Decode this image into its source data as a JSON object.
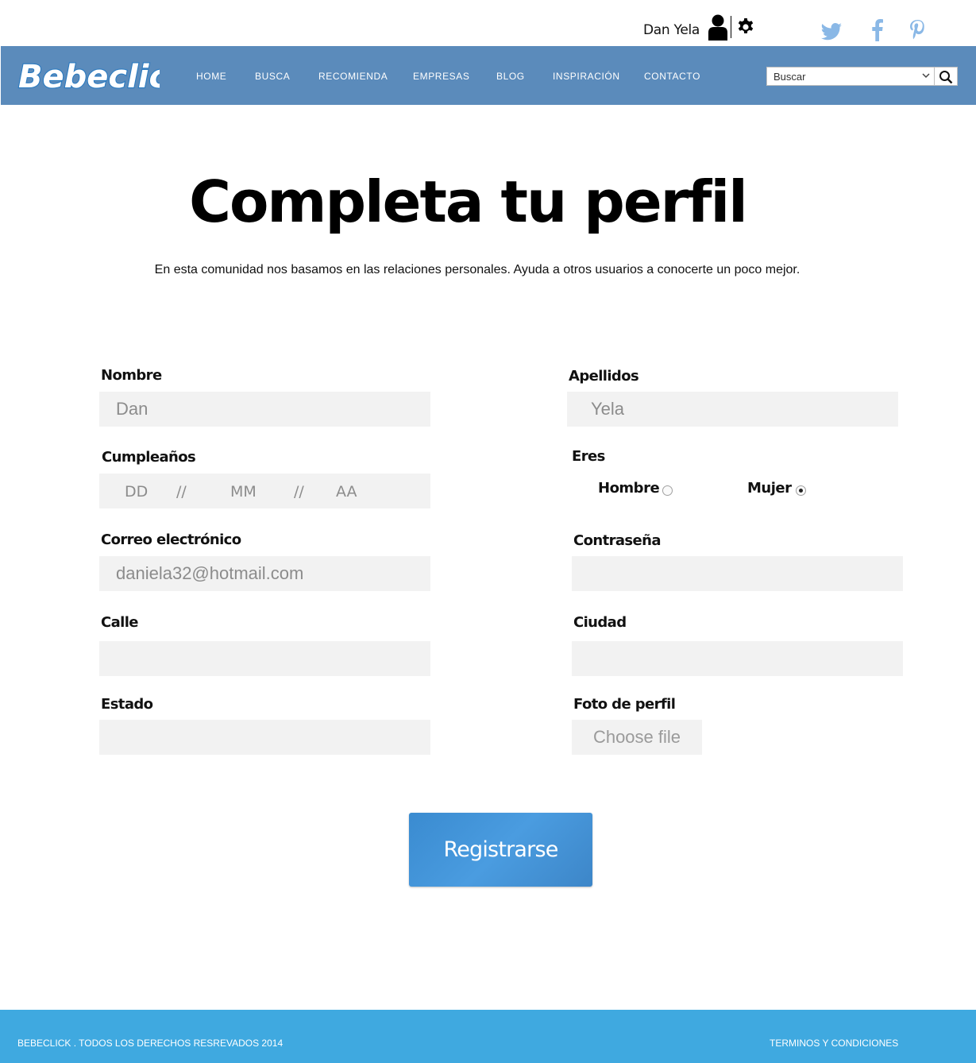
{
  "user": {
    "name": "Dan Yela"
  },
  "icons": {
    "user": "user-icon",
    "settings": "gear-icon",
    "social": [
      "twitter-icon",
      "facebook-icon",
      "pinterest-icon"
    ]
  },
  "brand": {
    "logo_text": "Bebeclick",
    "nav_color": "#5b8bbb",
    "footer_color": "#3fa9e0",
    "button_color": "#4a9ce0"
  },
  "nav": {
    "items": [
      "HOME",
      "BUSCA",
      "RECOMIENDA",
      "EMPRESAS",
      "BLOG",
      "INSPIRACIÓN",
      "CONTACTO"
    ],
    "search_select_value": "Buscar"
  },
  "header": {
    "title": "Completa tu perfil",
    "subtitle": "En esta comunidad nos basamos en las relaciones personales. Ayuda a otros usuarios a conocerte un poco mejor."
  },
  "form": {
    "nombre": {
      "label": "Nombre",
      "value": "Dan"
    },
    "apellidos": {
      "label": "Apellidos",
      "value": "Yela"
    },
    "cumpleanos": {
      "label": "Cumpleaños",
      "day": "DD",
      "sep1": "//",
      "month": "MM",
      "sep2": "//",
      "year": "AA"
    },
    "eres": {
      "label": "Eres",
      "option_male": "Hombre",
      "option_female": "Mujer",
      "selected": "Mujer"
    },
    "correo": {
      "label": "Correo electrónico",
      "value": "daniela32@hotmail.com"
    },
    "contrasena": {
      "label": "Contraseña",
      "value": ""
    },
    "calle": {
      "label": "Calle",
      "value": ""
    },
    "ciudad": {
      "label": "Ciudad",
      "value": ""
    },
    "estado": {
      "label": "Estado",
      "value": ""
    },
    "foto": {
      "label": "Foto de perfil",
      "button": "Choose file"
    },
    "submit": "Registrarse"
  },
  "footer": {
    "copyright": "BEBECLICK . TODOS LOS DERECHOS RESREVADOS 2014",
    "terms": "TERMINOS Y CONDICIONES"
  }
}
